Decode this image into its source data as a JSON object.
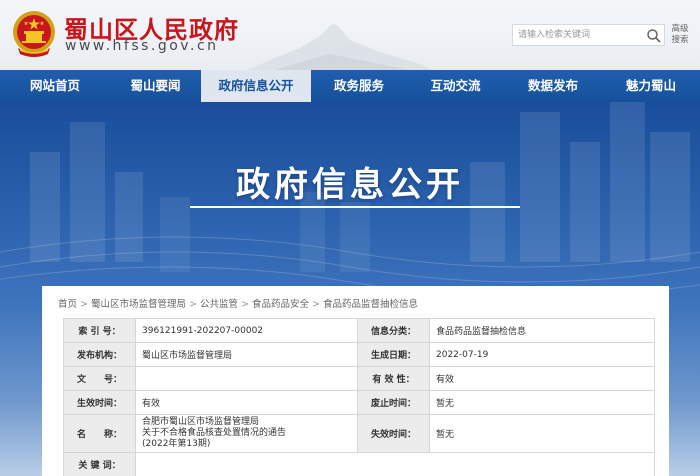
{
  "header": {
    "site_title": "蜀山区人民政府",
    "site_url": "www.hfss.gov.cn",
    "search_placeholder": "请输入检索关键词",
    "advanced_search_line1": "高级",
    "advanced_search_line2": "搜索"
  },
  "nav": {
    "items": [
      {
        "label": "网站首页"
      },
      {
        "label": "蜀山要闻"
      },
      {
        "label": "政府信息公开",
        "active": true
      },
      {
        "label": "政务服务"
      },
      {
        "label": "互动交流"
      },
      {
        "label": "数据发布"
      },
      {
        "label": "魅力蜀山"
      }
    ]
  },
  "banner": {
    "title": "政府信息公开"
  },
  "breadcrumb": [
    "首页",
    "蜀山区市场监督管理局",
    "公共监管",
    "食品药品安全",
    "食品药品监督抽检信息"
  ],
  "breadcrumb_separator": ">",
  "info_table": {
    "index_label": "索 引 号：",
    "index_value": "396121991-202207-00002",
    "category_label": "信息分类：",
    "category_value": "食品药品监督抽检信息",
    "publisher_label": "发布机构：",
    "publisher_value": "蜀山区市场监督管理局",
    "date_label": "生成日期：",
    "date_value": "2022-07-19",
    "docno_label": "文　　号：",
    "docno_value": "",
    "validity_label": "有 效 性：",
    "validity_value": "有效",
    "effective_label": "生效时间：",
    "effective_value": "有效",
    "repeal_label": "废止时间：",
    "repeal_value": "暂无",
    "name_label": "名　　称：",
    "name_line1": "合肥市蜀山区市场监督管理局",
    "name_line2": "关于不合格食品核查处置情况的通告",
    "name_line3": "(2022年第13期)",
    "expire_label": "失效时间：",
    "expire_value": "暂无",
    "keywords_label": "关 键 词：",
    "keywords_value": ""
  },
  "colors": {
    "brand_red": "#c8161d",
    "nav_blue": "#16509b",
    "nav_active_bg": "#dfe6ef"
  }
}
